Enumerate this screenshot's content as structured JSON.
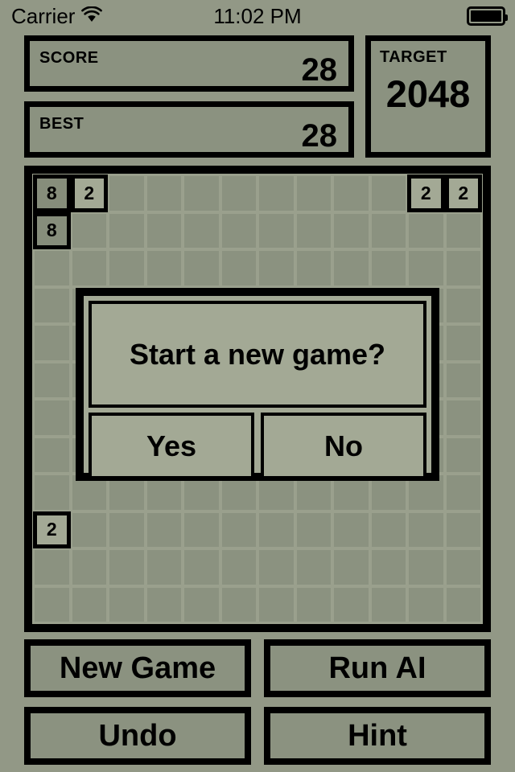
{
  "status_bar": {
    "carrier": "Carrier",
    "wifi_icon": "wifi-icon",
    "time": "11:02 PM",
    "battery_icon": "battery-icon"
  },
  "scores": {
    "score_label": "SCORE",
    "score_value": "28",
    "best_label": "BEST",
    "best_value": "28",
    "target_label": "TARGET",
    "target_value": "2048"
  },
  "board": {
    "columns": 12,
    "rows": 12,
    "tiles": [
      {
        "row": 0,
        "col": 0,
        "value": "8"
      },
      {
        "row": 0,
        "col": 1,
        "value": "2"
      },
      {
        "row": 0,
        "col": 10,
        "value": "2"
      },
      {
        "row": 0,
        "col": 11,
        "value": "2"
      },
      {
        "row": 1,
        "col": 0,
        "value": "8"
      },
      {
        "row": 9,
        "col": 0,
        "value": "2"
      }
    ]
  },
  "dialog": {
    "message": "Start a new game?",
    "yes_label": "Yes",
    "no_label": "No"
  },
  "buttons": {
    "new_game": "New Game",
    "run_ai": "Run AI",
    "undo": "Undo",
    "hint": "Hint"
  },
  "colors": {
    "page_background": "#929886",
    "cell": "#8b9280",
    "board_inner": "#9aa08d",
    "dialog": "#a3a995",
    "tile_2": "#a3a995",
    "tile_8": "#868d7b",
    "border": "#000000",
    "text": "#000000"
  }
}
